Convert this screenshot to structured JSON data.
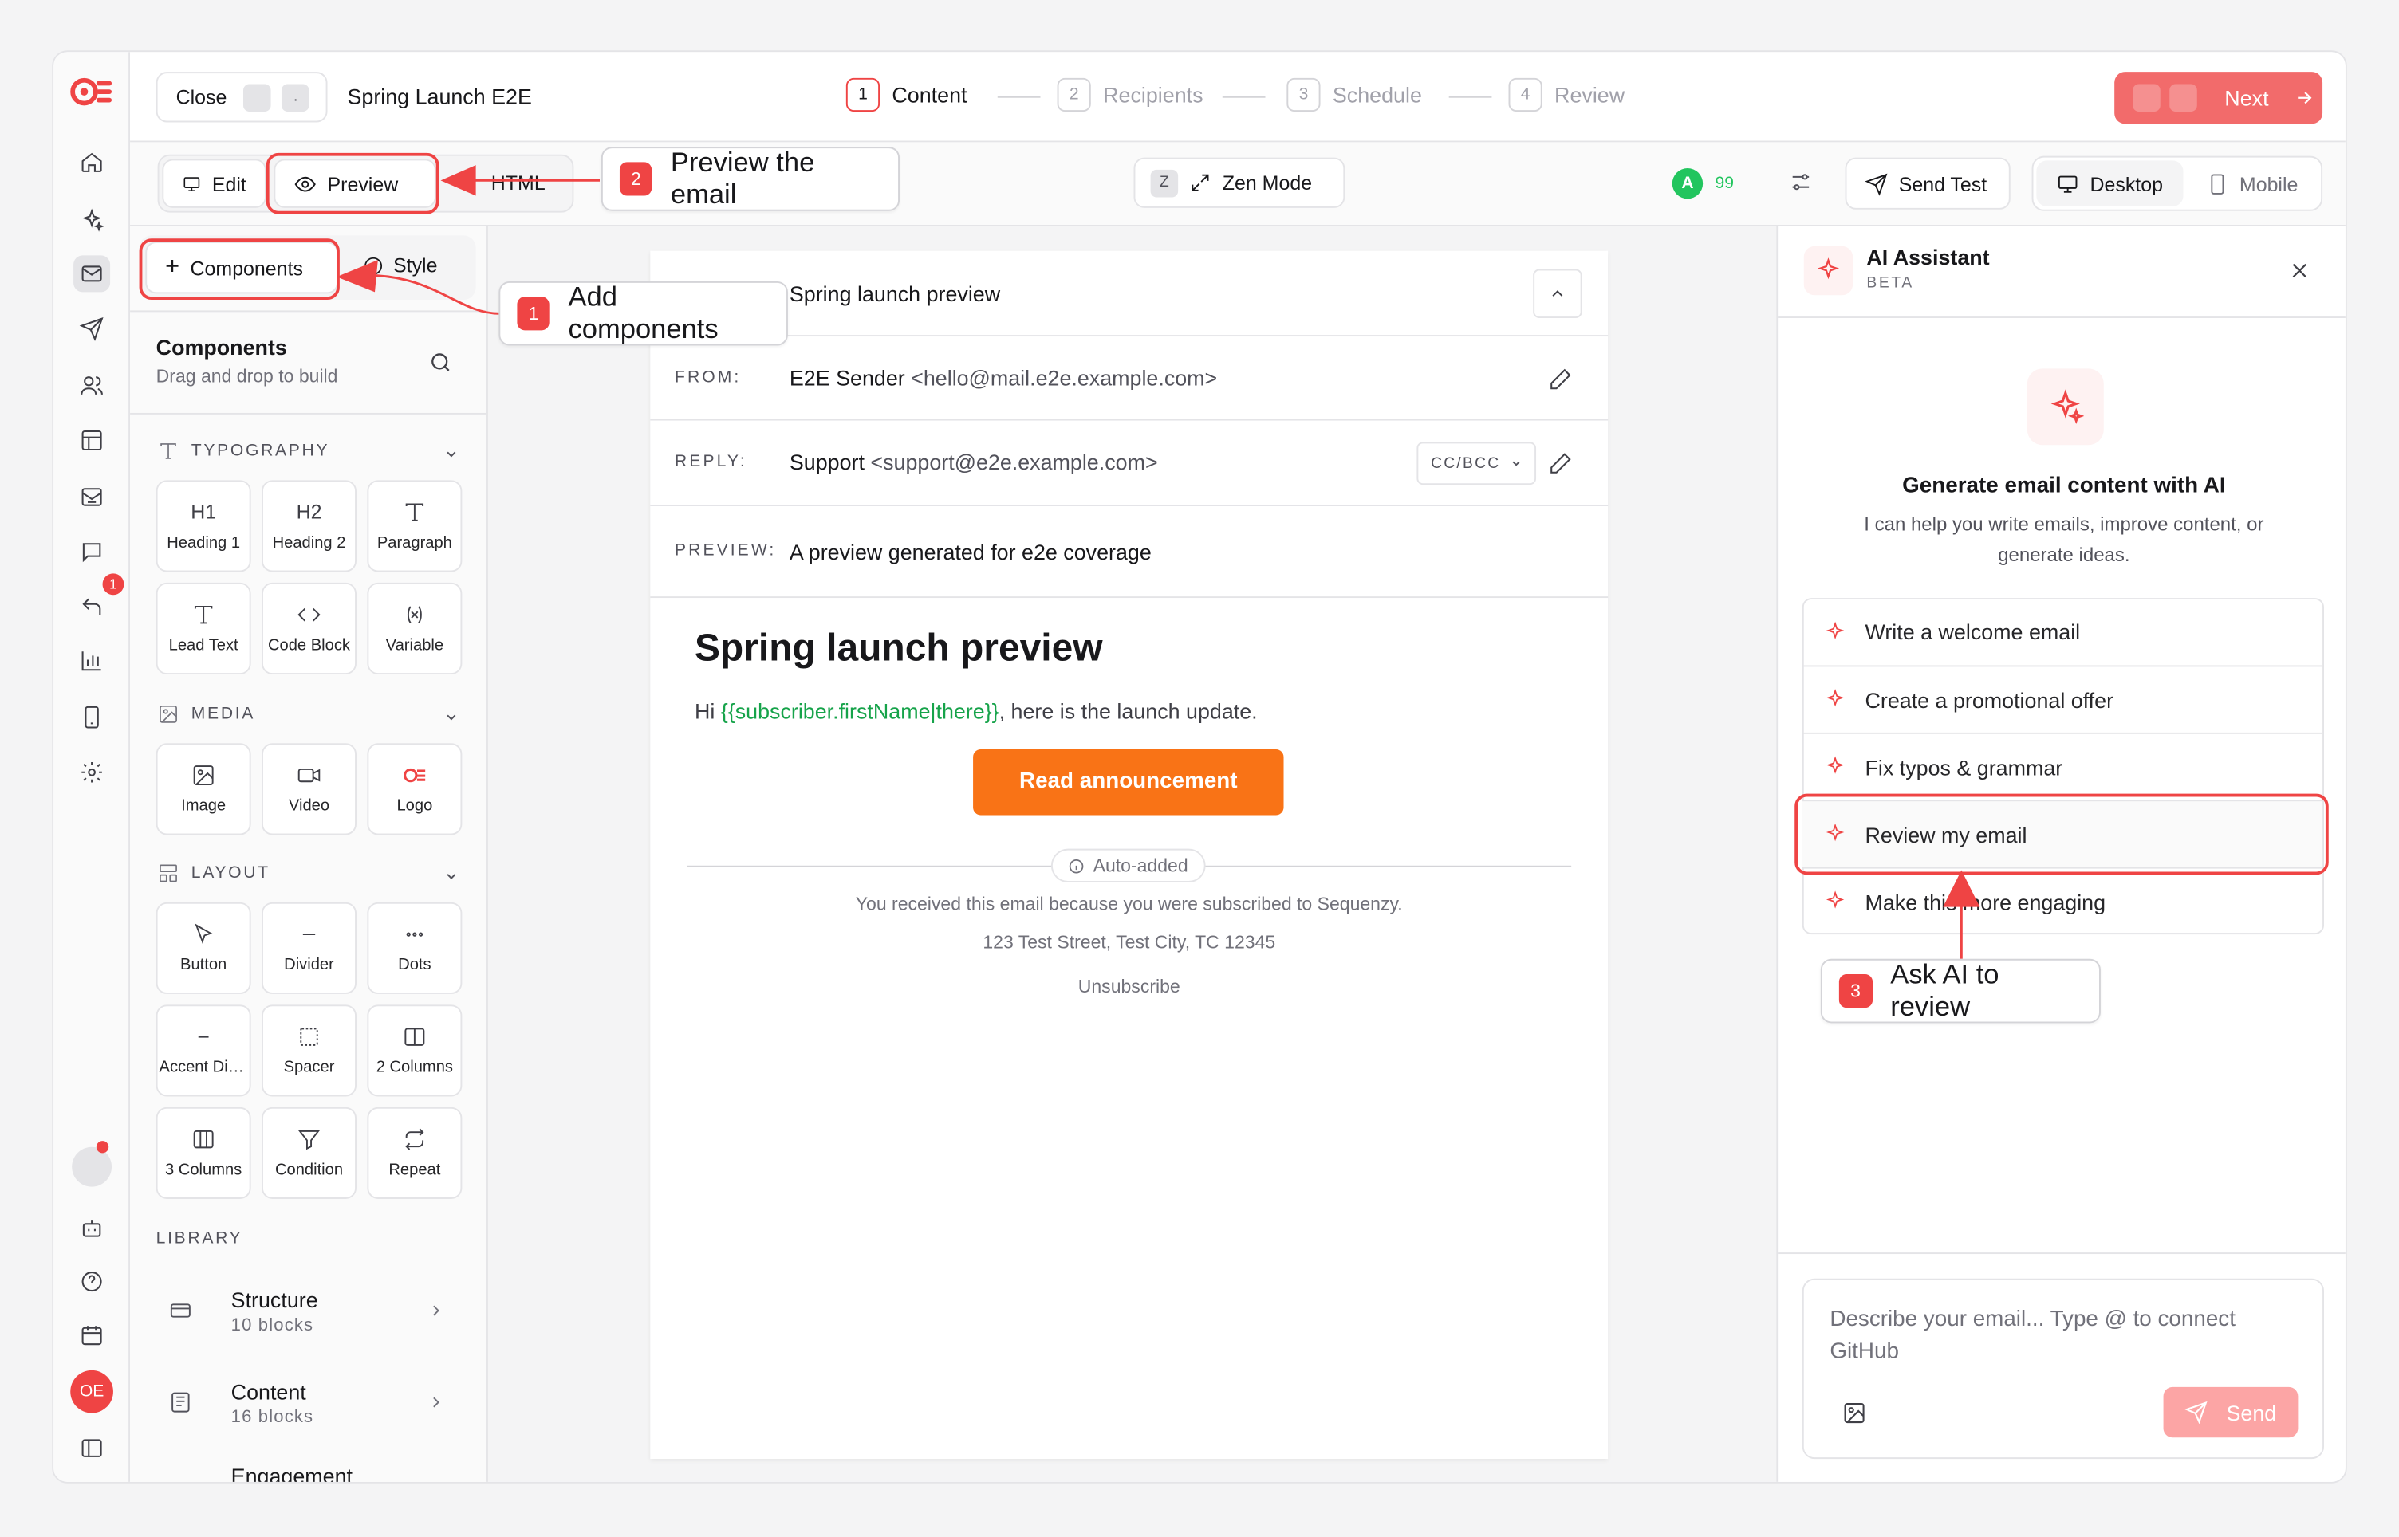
{
  "header": {
    "close_label": "Close",
    "close_kbd1": "",
    "close_kbd2": ".",
    "campaign_name": "Spring Launch E2E",
    "steps": [
      {
        "num": "1",
        "label": "Content"
      },
      {
        "num": "2",
        "label": "Recipients"
      },
      {
        "num": "3",
        "label": "Schedule"
      },
      {
        "num": "4",
        "label": "Review"
      }
    ],
    "next_label": "Next"
  },
  "toolbar": {
    "edit_label": "Edit",
    "preview_label": "Preview",
    "html_label": "HTML",
    "zen_kbd": "Z",
    "zen_label": "Zen Mode",
    "grade": "A",
    "score": "99",
    "send_test_label": "Send Test",
    "desktop_label": "Desktop",
    "mobile_label": "Mobile"
  },
  "left_panel": {
    "tab_components": "Components",
    "tab_style": "Style",
    "title": "Components",
    "subtitle": "Drag and drop to build",
    "sections": {
      "typography": "TYPOGRAPHY",
      "media": "MEDIA",
      "layout": "LAYOUT",
      "library": "LIBRARY"
    },
    "typography_items": [
      "Heading 1",
      "Heading 2",
      "Paragraph",
      "Lead Text",
      "Code Block",
      "Variable"
    ],
    "typography_glyphs": [
      "H1",
      "H2"
    ],
    "media_items": [
      "Image",
      "Video",
      "Logo"
    ],
    "layout_items": [
      "Button",
      "Divider",
      "Dots",
      "Accent Divider",
      "Spacer",
      "2 Columns",
      "3 Columns",
      "Condition",
      "Repeat"
    ],
    "library": [
      {
        "title": "Structure",
        "subtitle": "10 blocks"
      },
      {
        "title": "Content",
        "subtitle": "16 blocks"
      },
      {
        "title": "Engagement",
        "subtitle": ""
      }
    ]
  },
  "email": {
    "subject": "Spring launch preview",
    "from_label": "FROM:",
    "from_name": "E2E Sender",
    "from_email": "<hello@mail.e2e.example.com>",
    "reply_label": "REPLY:",
    "reply_name": "Support",
    "reply_email": "<support@e2e.example.com>",
    "ccbcc_label": "CC/BCC",
    "preview_label": "PREVIEW:",
    "preview_text": "A preview generated for e2e coverage",
    "heading": "Spring launch preview",
    "body_prefix": "Hi ",
    "body_variable": "{{subscriber.firstName|there}}",
    "body_suffix": ", here is the launch update.",
    "cta_label": "Read announcement",
    "auto_added_label": "Auto-added",
    "footer_text": "You received this email because you were subscribed to Sequenzy.",
    "footer_address": "123 Test Street, Test City, TC 12345",
    "unsubscribe": "Unsubscribe"
  },
  "ai_panel": {
    "title": "AI Assistant",
    "badge": "BETA",
    "headline": "Generate email content with AI",
    "description_line1": "I can help you write emails, improve content, or",
    "description_line2": "generate ideas.",
    "suggestions": [
      "Write a welcome email",
      "Create a promotional offer",
      "Fix typos & grammar",
      "Review my email",
      "Make this more engaging"
    ],
    "input_placeholder": "Describe your email... Type @ to connect GitHub",
    "send_label": "Send"
  },
  "sidebar": {
    "notification_count": "1",
    "avatar_initials": "OE"
  },
  "annotations": [
    {
      "num": "1",
      "label": "Add components"
    },
    {
      "num": "2",
      "label": "Preview the email"
    },
    {
      "num": "3",
      "label": "Ask AI to review"
    }
  ],
  "colors": {
    "accent": "#ef4444",
    "next_button": "#f26b6b",
    "cta_orange": "#f97316",
    "variable_green": "#16a34a",
    "score_green": "#22c55e"
  }
}
